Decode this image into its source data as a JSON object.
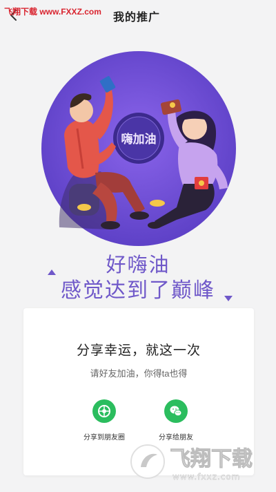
{
  "header": {
    "title": "我的推广",
    "watermark": "飞翔下载 www.FXXZ.com"
  },
  "hero": {
    "badge_text": "嗨加油"
  },
  "tagline": {
    "line1": "好嗨油",
    "line2": "感觉达到了巅峰"
  },
  "card": {
    "title": "分享幸运，就这一次",
    "subtitle": "请好友加油，你得ta也得",
    "share_moments_label": "分享到朋友圈",
    "share_friends_label": "分享给朋友"
  },
  "watermark_brand": {
    "name": "飞翔下载",
    "url": "www.fxxz.com"
  },
  "colors": {
    "accent_purple": "#6f58c9",
    "share_green": "#2bbd5e",
    "watermark_red": "#d9232e"
  },
  "icons": {
    "back": "back-arrow-icon",
    "moments": "moments-icon",
    "wechat": "wechat-icon"
  }
}
